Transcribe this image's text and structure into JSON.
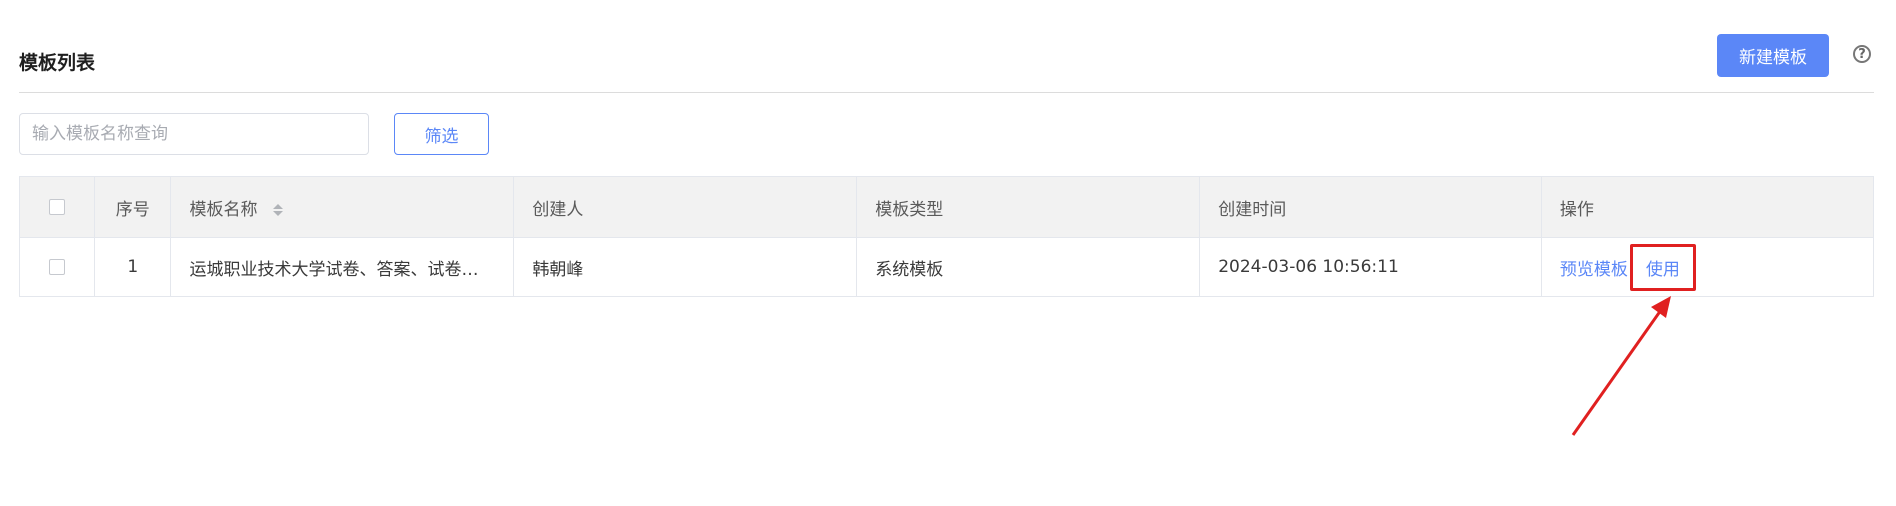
{
  "header": {
    "title": "模板列表",
    "new_button_label": "新建模板",
    "help_icon": "question-circle-icon",
    "help_glyph": "?"
  },
  "filter": {
    "search_placeholder": "输入模板名称查询",
    "search_value": "",
    "filter_button_label": "筛选"
  },
  "table": {
    "columns": {
      "index": "序号",
      "name": "模板名称",
      "creator": "创建人",
      "type": "模板类型",
      "created_at": "创建时间",
      "actions": "操作"
    },
    "rows": [
      {
        "index": "1",
        "name": "运城职业技术大学试卷、答案、试卷分析模板",
        "creator": "韩朝峰",
        "type": "系统模板",
        "created_at": "2024-03-06 10:56:11",
        "preview_label": "预览模板",
        "use_label": "使用"
      }
    ]
  },
  "annotation": {
    "highlight_color": "#e02020",
    "arrow_color": "#e02020"
  },
  "colors": {
    "primary": "#5b87f7"
  }
}
